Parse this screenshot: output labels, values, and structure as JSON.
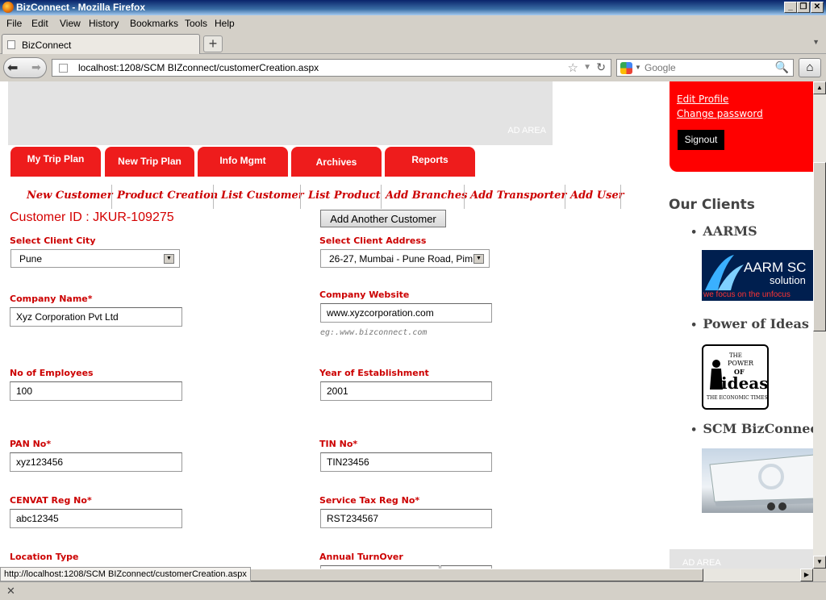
{
  "window": {
    "title": "BizConnect - Mozilla Firefox"
  },
  "menu": [
    "File",
    "Edit",
    "View",
    "History",
    "Bookmarks",
    "Tools",
    "Help"
  ],
  "tab": {
    "label": "BizConnect"
  },
  "nav": {
    "url": "localhost:1208/SCM BIZconnect/customerCreation.aspx",
    "search_placeholder": "Google"
  },
  "page": {
    "ad_label": "AD AREA",
    "main_tabs": [
      "My Trip Plan",
      "New Trip Plan",
      "Info Mgmt",
      "Archives",
      "Reports"
    ],
    "sub_menu": [
      "New Customer",
      "Product Creation",
      "List Customer",
      "List Product",
      "Add Branches",
      "Add Transporter",
      "Add User"
    ],
    "customer_id": "Customer ID : JKUR-109275",
    "add_another": "Add Another Customer",
    "fields": {
      "client_city_label": "Select Client City",
      "client_city_value": "Pune",
      "client_address_label": "Select Client Address",
      "client_address_value": "26-27, Mumbai - Pune Road, Pim",
      "company_name_label": "Company Name*",
      "company_name_value": "Xyz Corporation Pvt Ltd",
      "company_website_label": "Company Website",
      "company_website_value": "www.xyzcorporation.com",
      "website_hint": "eg:.www.bizconnect.com",
      "employees_label": "No of Employees",
      "employees_value": "100",
      "year_label": "Year of Establishment",
      "year_value": "2001",
      "pan_label": "PAN No*",
      "pan_value": "xyz123456",
      "tin_label": "TIN No*",
      "tin_value": "TIN23456",
      "cenvat_label": "CENVAT Reg No*",
      "cenvat_value": "abc12345",
      "service_tax_label": "Service Tax Reg No*",
      "service_tax_value": "RST234567",
      "location_type_label": "Location Type",
      "annual_turnover_label": "Annual TurnOver"
    },
    "sidebar": {
      "edit_profile": "Edit Profile",
      "change_password": "Change password",
      "signout": "Signout",
      "clients_title": "Our Clients",
      "clients": [
        "AARMS",
        "Power of Ideas",
        "SCM BizConnect"
      ],
      "logo1_text1": "AARM SC",
      "logo1_text2": "solution",
      "logo1_tagline": "we focus on the unfocus",
      "logo2_text1": "THE",
      "logo2_text2": "POWER",
      "logo2_text3": "OF",
      "logo2_text4": "ideas",
      "logo2_text5": "THE ECONOMIC TIMES",
      "ad_label": "AD AREA"
    }
  },
  "status": {
    "link": "http://localhost:1208/SCM BIZconnect/customerCreation.aspx"
  },
  "colors": {
    "brand_red": "#ee1c1c",
    "label_red": "#cc0000",
    "titlebar_blue": "#0a246a"
  }
}
